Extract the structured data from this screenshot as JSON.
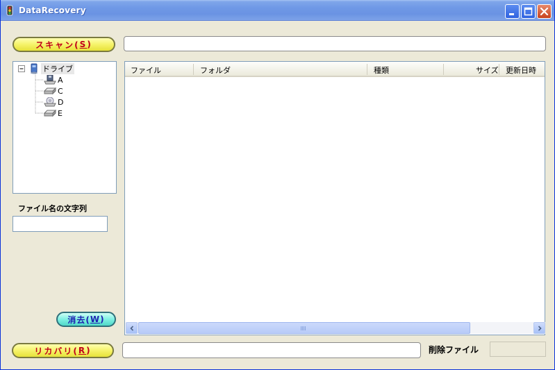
{
  "window": {
    "title": "DataRecovery"
  },
  "toolbar": {
    "scan_label": "スキャン(",
    "scan_key": "S",
    "scan_suffix": ")",
    "scan_path_value": ""
  },
  "tree": {
    "root_label": "ドライブ",
    "items": [
      {
        "label": "A",
        "icon": "floppy-drive-icon"
      },
      {
        "label": "C",
        "icon": "hard-drive-icon"
      },
      {
        "label": "D",
        "icon": "cd-drive-icon"
      },
      {
        "label": "E",
        "icon": "hard-drive-icon"
      }
    ]
  },
  "filter": {
    "label": "ファイル名の文字列",
    "value": ""
  },
  "list": {
    "columns": [
      "ファイル",
      "フォルダ",
      "種類",
      "サイズ",
      "更新日時"
    ],
    "rows": []
  },
  "clear": {
    "label": "消去(",
    "key": "W",
    "suffix": ")"
  },
  "recover": {
    "label": "リカバリ(",
    "key": "R",
    "suffix": ")",
    "path_value": ""
  },
  "status": {
    "deleted_files_label": "削除ファイル",
    "deleted_files_value": ""
  },
  "colors": {
    "titlebar": "#6a93e3",
    "button_yellow": "#f6f36a",
    "button_cyan": "#7ff0e2",
    "button_text_red": "#c0001a"
  }
}
